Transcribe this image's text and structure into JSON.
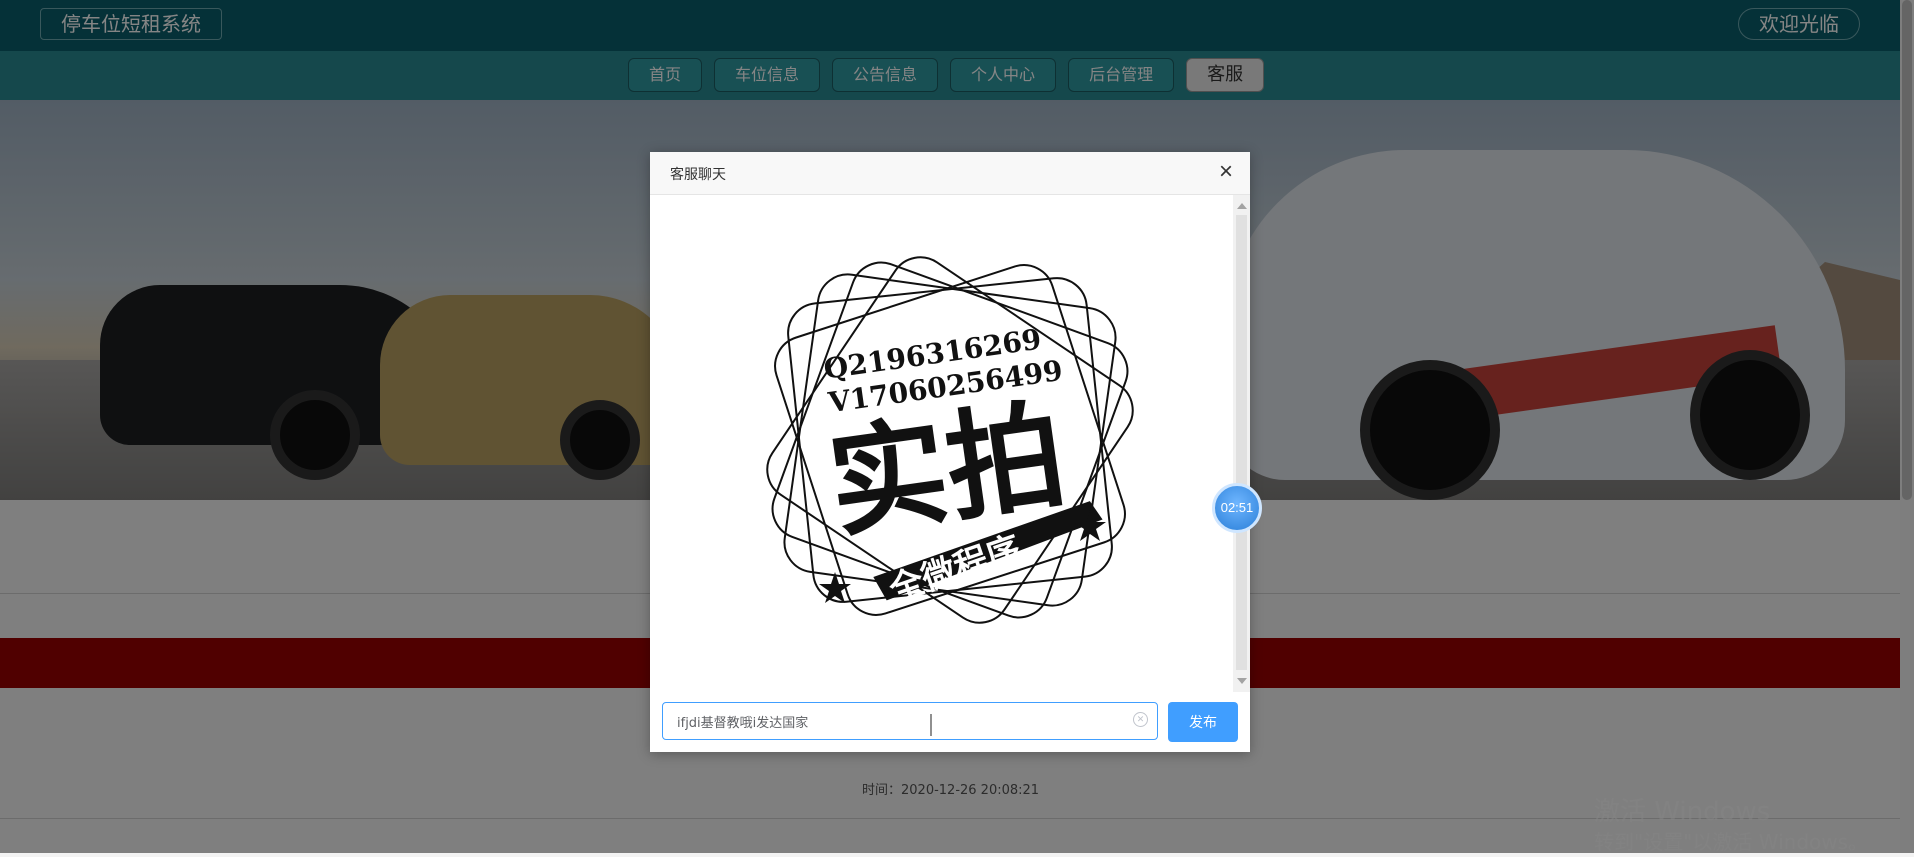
{
  "header": {
    "brand": "停车位短租系统",
    "welcome": "欢迎光临"
  },
  "nav": {
    "items": [
      {
        "label": "首页"
      },
      {
        "label": "车位信息"
      },
      {
        "label": "公告信息"
      },
      {
        "label": "个人中心"
      },
      {
        "label": "后台管理"
      },
      {
        "label": "客服"
      }
    ],
    "active": "客服"
  },
  "content": {
    "time_text": "时间：2020-12-26 20:08:21"
  },
  "watermark": {
    "line1": "激活 Windows",
    "line2": "转到\"设置\"以激活 Windows。"
  },
  "dialog": {
    "title": "客服聊天",
    "stamp": {
      "line1": "Q2196316269",
      "line2": "V17060256499",
      "main": "实拍",
      "ribbon": "全微程序"
    },
    "input_value": "ifjdi基督教哦i发达国家",
    "send_label": "发布"
  },
  "timer": {
    "value": "02:51"
  },
  "colors": {
    "header": "#0b5f6b",
    "navbar": "#2a8a92",
    "primary": "#409eff",
    "red_strip": "#990000"
  }
}
